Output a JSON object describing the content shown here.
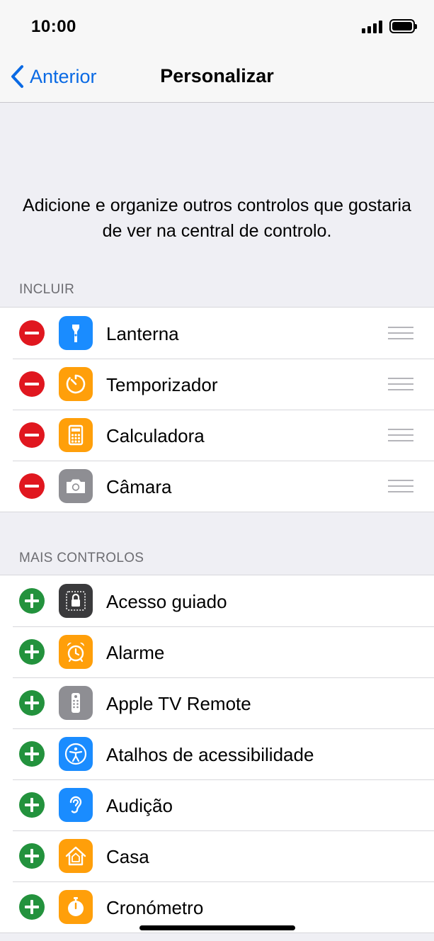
{
  "status_bar": {
    "time": "10:00"
  },
  "nav": {
    "back_label": "Anterior",
    "title": "Personalizar"
  },
  "description": "Adicione e organize outros controlos que gostaria de ver na central de controlo.",
  "include_section": {
    "header": "INCLUIR",
    "items": [
      {
        "label": "Lanterna",
        "icon": "flashlight-icon",
        "color": "#1a8cff"
      },
      {
        "label": "Temporizador",
        "icon": "timer-icon",
        "color": "#ff9f0a"
      },
      {
        "label": "Calculadora",
        "icon": "calculator-icon",
        "color": "#ff9f0a"
      },
      {
        "label": "Câmara",
        "icon": "camera-icon",
        "color": "#8e8e93"
      }
    ]
  },
  "more_section": {
    "header": "MAIS CONTROLOS",
    "items": [
      {
        "label": "Acesso guiado",
        "icon": "lock-icon",
        "color": "#3a3a3c"
      },
      {
        "label": "Alarme",
        "icon": "alarm-clock-icon",
        "color": "#ff9f0a"
      },
      {
        "label": "Apple TV Remote",
        "icon": "remote-icon",
        "color": "#8e8e93"
      },
      {
        "label": "Atalhos de acessibilidade",
        "icon": "accessibility-icon",
        "color": "#1a8cff"
      },
      {
        "label": "Audição",
        "icon": "ear-icon",
        "color": "#1a8cff"
      },
      {
        "label": "Casa",
        "icon": "home-icon",
        "color": "#ff9f0a"
      },
      {
        "label": "Cronómetro",
        "icon": "stopwatch-icon",
        "color": "#ff9f0a"
      }
    ]
  },
  "colors": {
    "accent": "#0a6ae4",
    "remove": "#e0171f",
    "add": "#23923d"
  }
}
